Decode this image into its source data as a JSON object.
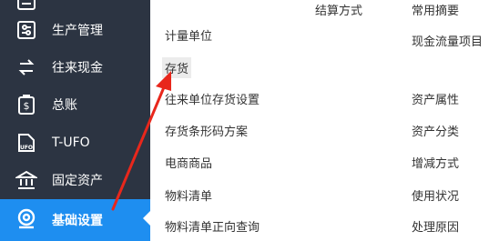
{
  "sidebar": {
    "items": [
      {
        "label": "",
        "icon": "ledger-icon"
      },
      {
        "label": "生产管理",
        "icon": "production-icon"
      },
      {
        "label": "往来现金",
        "icon": "exchange-icon"
      },
      {
        "label": "总账",
        "icon": "general-ledger-icon"
      },
      {
        "label": "T-UFO",
        "icon": "ufo-report-icon"
      },
      {
        "label": "固定资产",
        "icon": "fixed-asset-icon"
      },
      {
        "label": "基础设置",
        "icon": "basic-settings-icon",
        "active": true
      }
    ]
  },
  "menu": {
    "col1": [
      "计量单位",
      "存货",
      "往来单位存货设置",
      "存货条形码方案",
      "电商商品",
      "物料清单",
      "物料清单正向查询"
    ],
    "col1_highlighted": "存货",
    "col2": [
      "结算方式"
    ],
    "col3": [
      "常用摘要",
      "现金流量项目",
      "资产属性",
      "资产分类",
      "增减方式",
      "使用状况",
      "处理原因"
    ]
  },
  "colors": {
    "sidebar_bg": "#2c3442",
    "active_bg": "#1e8ef0",
    "arrow": "#e8271c"
  }
}
